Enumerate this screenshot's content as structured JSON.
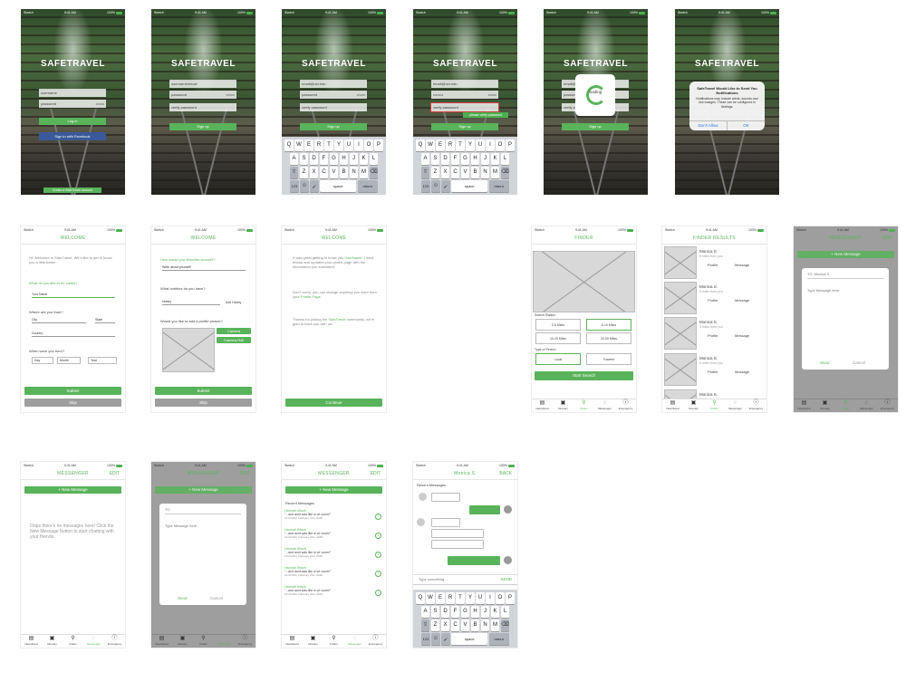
{
  "status": {
    "carrier": "Sketch",
    "time": "9:41 AM",
    "battery": "100%"
  },
  "brand": "SAFETRAVEL",
  "login": {
    "user_placeholder": "username",
    "pass_placeholder": "password",
    "show": "show",
    "login": "Log in",
    "facebook": "Sign in with Facebook",
    "create": "Create a SafeTravel account"
  },
  "signup": {
    "user": "username/email",
    "pass": "password",
    "verify": "verify password",
    "signup": "Sign up",
    "email": "email@uci.edu",
    "email2": "email@uci.edu",
    "dots": "••••••••",
    "verify_err": "please verify password"
  },
  "keyboard": {
    "row1": [
      "Q",
      "W",
      "E",
      "R",
      "T",
      "Y",
      "U",
      "I",
      "O",
      "P"
    ],
    "row2": [
      "A",
      "S",
      "D",
      "F",
      "G",
      "H",
      "J",
      "K",
      "L"
    ],
    "row3": [
      "Z",
      "X",
      "C",
      "V",
      "B",
      "N",
      "M"
    ],
    "num": "123",
    "space": "space",
    "return": "return",
    "shift": "⇧",
    "del": "⌫",
    "emoji": "☺",
    "mic": "🎤"
  },
  "loading": "loading",
  "alert": {
    "title": "SafeTravel Would Like to Send You Notifications",
    "body": "Notifications may include alerts, sounds and icon badges. These can be configured in Settings.",
    "deny": "Don't Allow",
    "ok": "OK"
  },
  "welcome": {
    "title": "WELCOME",
    "intro": "Hi! Welcome to SafeTravel. We'd like to get to know you a little better.",
    "called": "What do you like to be called?",
    "name_ph": "Your Name",
    "from": "Where are you from?",
    "city": "City",
    "state": "State",
    "country": "Country",
    "born": "When were you born?",
    "day": "Day",
    "month": "Month",
    "year": "Year",
    "submit": "Submit",
    "skip": "Skip",
    "describe": "How would you describe yourself?",
    "describe_ph": "Write about yourself!",
    "hobbies": "What hobbies do you have?",
    "hobby": "Hobby",
    "add_hobby": "Add Hobby",
    "picture": "Would you like to add a profile picture?",
    "camera": "Camera",
    "roll": "Camera Roll",
    "done1": "It was great getting to know you",
    "username": "UserName",
    "done2": ". I went ahead and updated your profile page with the information you submitted.",
    "done3": "Don't worry, you can change anything you want from your",
    "profile": "Profile Page",
    "done4": "Thanks for joining the",
    "st": "SafeTravel",
    "done5": "community, we're glad to have you with us!",
    "continue": "Continue"
  },
  "finder": {
    "title": "FINDER",
    "radius": "Search Radius",
    "r1": "0-5 Miles",
    "r2": "5-10 Miles",
    "r3": "10-20 Miles",
    "r4": "20-50 Miles",
    "type": "Type of Person",
    "local": "Local",
    "traveler": "Traveler",
    "start": "Start Search"
  },
  "results": {
    "title": "FINDER RESULTS",
    "name": "Monica S.",
    "dist": "5 miles from you",
    "profile": "Profile",
    "message": "Message"
  },
  "tabs": [
    "NewsFeed",
    "Itinerary",
    "Finder",
    "Messenger",
    "Emergency"
  ],
  "messenger": {
    "title": "MESSENGER",
    "edit": "EDIT",
    "new": "+ New Message",
    "to": "TO:",
    "to_name": "Monica S.",
    "to_blank": "TO",
    "type_ph": "Type Message here",
    "send": "Send",
    "cancel": "Cancel",
    "empty": "Oops there's no messages here! Click the New Message button to start chatting with your friends.",
    "recent": "Recent Messages",
    "sender": "Hannah Kitsch",
    "preview": "\"...and aunt was like w ve voom!\"",
    "time": "12:23 AM | February 21st, 2018"
  },
  "chat": {
    "title": "Monica S.",
    "back": "BACK",
    "recent": "Recent Messages",
    "type_ph": "Type something....",
    "send": "SEND"
  }
}
